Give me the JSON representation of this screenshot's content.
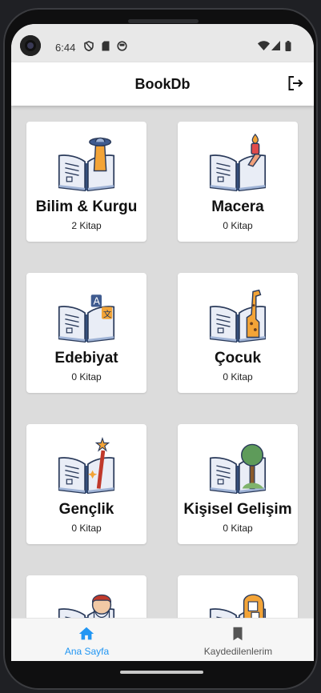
{
  "status_bar": {
    "time": "6:44",
    "icons": [
      "shield-icon",
      "sd-card-icon",
      "face-icon",
      "wifi-icon",
      "signal-icon",
      "battery-icon"
    ]
  },
  "app_bar": {
    "title": "BookDb",
    "action_icon": "logout-icon"
  },
  "categories": [
    {
      "title": "Bilim & Kurgu",
      "count": "2 Kitap",
      "icon": "book-ufo-icon"
    },
    {
      "title": "Macera",
      "count": "0 Kitap",
      "icon": "book-torch-icon"
    },
    {
      "title": "Edebiyat",
      "count": "0 Kitap",
      "icon": "book-translate-icon"
    },
    {
      "title": "Çocuk",
      "count": "0 Kitap",
      "icon": "book-giraffe-icon"
    },
    {
      "title": "Gençlik",
      "count": "0 Kitap",
      "icon": "book-wand-icon"
    },
    {
      "title": "Kişisel Gelişim",
      "count": "0 Kitap",
      "icon": "book-tree-icon"
    },
    {
      "title": "",
      "count": "",
      "icon": "book-portrait-icon"
    },
    {
      "title": "",
      "count": "",
      "icon": "book-puzzle-head-icon"
    }
  ],
  "bottom_nav": {
    "items": [
      {
        "label": "Ana Sayfa",
        "icon": "home-icon",
        "active": true
      },
      {
        "label": "Kaydedilenlerim",
        "icon": "bookmark-icon",
        "active": false
      }
    ],
    "active_color": "#2196f3",
    "inactive_color": "#555555"
  }
}
